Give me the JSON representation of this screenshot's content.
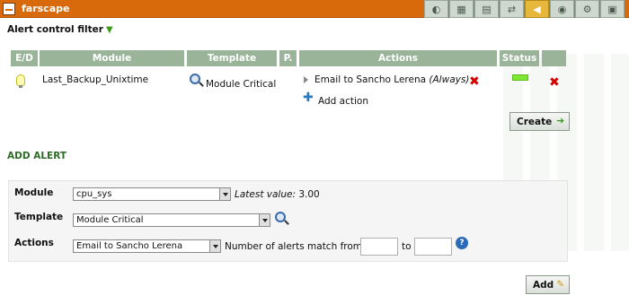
{
  "header": {
    "title": "farscape",
    "tabs": [
      "◐",
      "▦",
      "▤",
      "⇄",
      "◀",
      "◉",
      "⚙",
      "▣"
    ]
  },
  "filter_title": "Alert control filter",
  "table": {
    "headers": [
      "E/D",
      "Module",
      "Template",
      "P.",
      "Actions",
      "Status"
    ],
    "row": {
      "module": "Last_Backup_Unixtime",
      "template": "Module Critical",
      "action": "Email to Sancho Lerena",
      "action_note": "(Always)",
      "add_action": "Add action",
      "status_color": "#7ee834"
    }
  },
  "create_button": "Create",
  "add_alert_title": "ADD ALERT",
  "form": {
    "module_label": "Module",
    "module_value": "cpu_sys",
    "latest_value_label": "Latest value:",
    "latest_value": "3.00",
    "template_label": "Template",
    "template_value": "Module Critical",
    "actions_label": "Actions",
    "actions_value": "Email to Sancho Lerena",
    "match_label": "Number of alerts match from",
    "to_label": "to",
    "match_from": "",
    "match_to": ""
  },
  "add_button": "Add"
}
